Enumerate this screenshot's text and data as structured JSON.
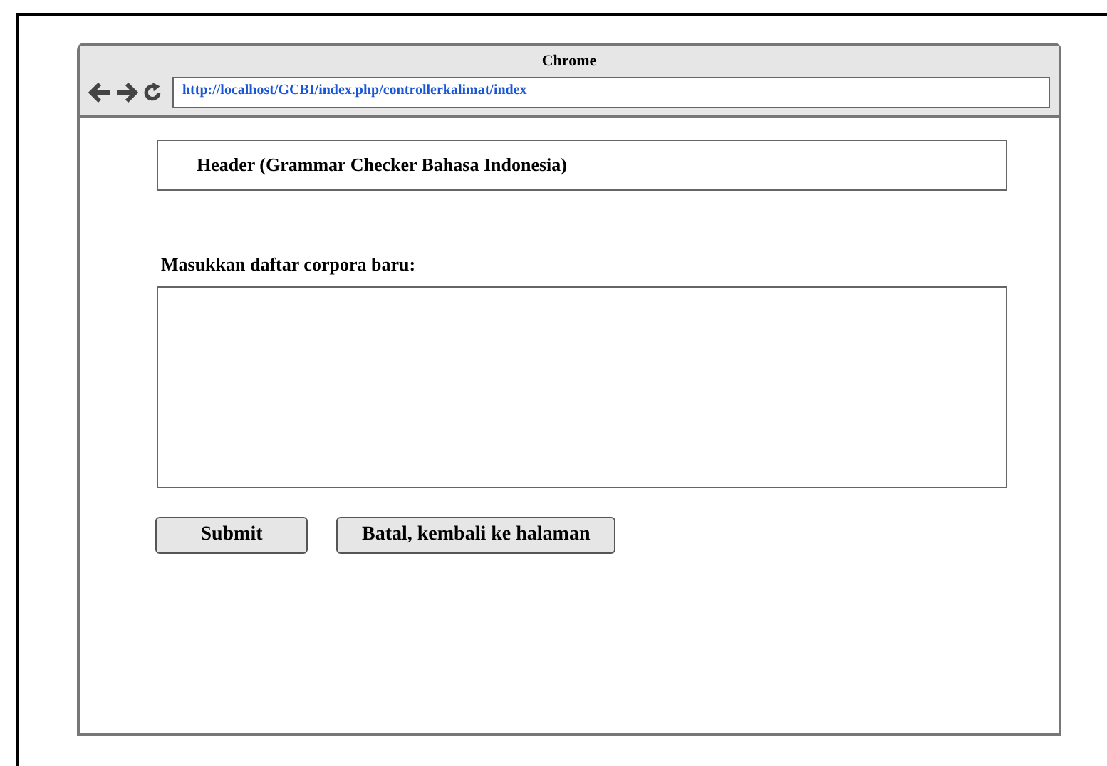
{
  "window": {
    "title": "Chrome"
  },
  "address_bar": {
    "value": "http://localhost/GCBI/index.php/controllerkalimat/index"
  },
  "header": {
    "text": "Header (Grammar Checker Bahasa Indonesia)"
  },
  "form": {
    "label": "Masukkan daftar corpora baru:"
  },
  "buttons": [
    {
      "label": "Submit"
    },
    {
      "label": "Batal, kembali ke halaman"
    }
  ]
}
